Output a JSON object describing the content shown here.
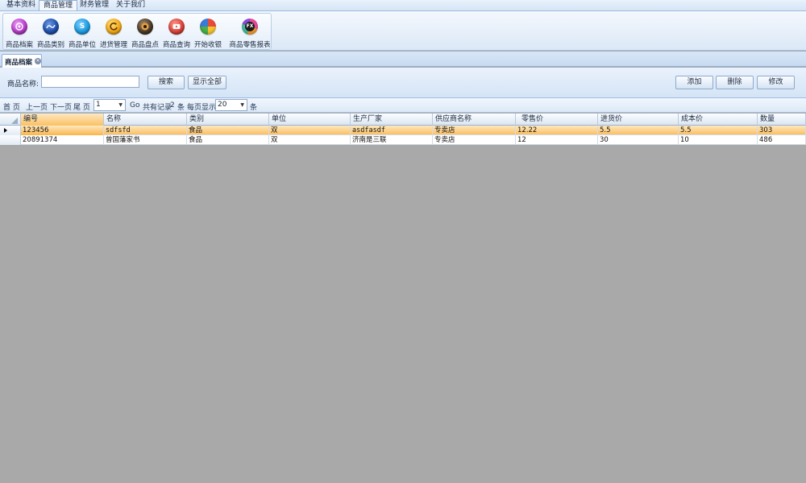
{
  "menu": {
    "tabs": [
      "基本资料",
      "商品管理",
      "财务管理",
      "关于我们"
    ],
    "active_index": 1
  },
  "ribbon": {
    "buttons": [
      {
        "label": "商品档案",
        "icon": "product-archive-icon",
        "color": "#b43cc8"
      },
      {
        "label": "商品类别",
        "icon": "product-category-icon",
        "color": "#1f4fa8"
      },
      {
        "label": "商品单位",
        "icon": "skype-unit-icon",
        "color": "#1c9be0"
      },
      {
        "label": "进货管理",
        "icon": "purchase-refresh-icon",
        "color": "#f0a818"
      },
      {
        "label": "商品盘点",
        "icon": "inventory-disc-icon",
        "color": "#4a3a2a"
      },
      {
        "label": "商品查询",
        "icon": "query-play-icon",
        "color": "#d8423a"
      },
      {
        "label": "开始收银",
        "icon": "cashier-pinwheel-icon",
        "color": "#7ab640"
      },
      {
        "label": "商品零售报表",
        "icon": "fx-report-icon",
        "color": "#c03ab0"
      }
    ]
  },
  "doc_tab": {
    "label": "商品档案"
  },
  "search": {
    "name_label": "商品名称:",
    "name_value": "",
    "search_label": "搜索",
    "show_all_label": "显示全部",
    "add_label": "添加",
    "delete_label": "删除",
    "edit_label": "修改"
  },
  "pager": {
    "first": "首 页",
    "prev": "上一页",
    "next": "下一页",
    "last": "尾 页",
    "page_value": "1",
    "go": "Go",
    "total_prefix": "共有记录",
    "total_count": "2",
    "total_suffix": "条",
    "per_page_label": "每页显示",
    "per_page_value": "20",
    "per_page_suffix": "条"
  },
  "table": {
    "columns": [
      "编号",
      "名称",
      "类别",
      "单位",
      "生产厂家",
      "供应商名称",
      "零售价",
      "进货价",
      "成本价",
      "数量"
    ],
    "rows": [
      [
        "123456",
        "sdfsfd",
        "食品",
        "双",
        "asdfasdf",
        "专卖店",
        "12.22",
        "5.5",
        "5.5",
        "303"
      ],
      [
        "20891374",
        "曾国藩家书",
        "食品",
        "双",
        "济南是三联",
        "专卖店",
        "12",
        "30",
        "10",
        "486"
      ]
    ],
    "selected_row": 0
  },
  "colors": {
    "selection": "#fbc063",
    "workspace": "#a9a9a9",
    "chrome": "#d6e5f6"
  }
}
